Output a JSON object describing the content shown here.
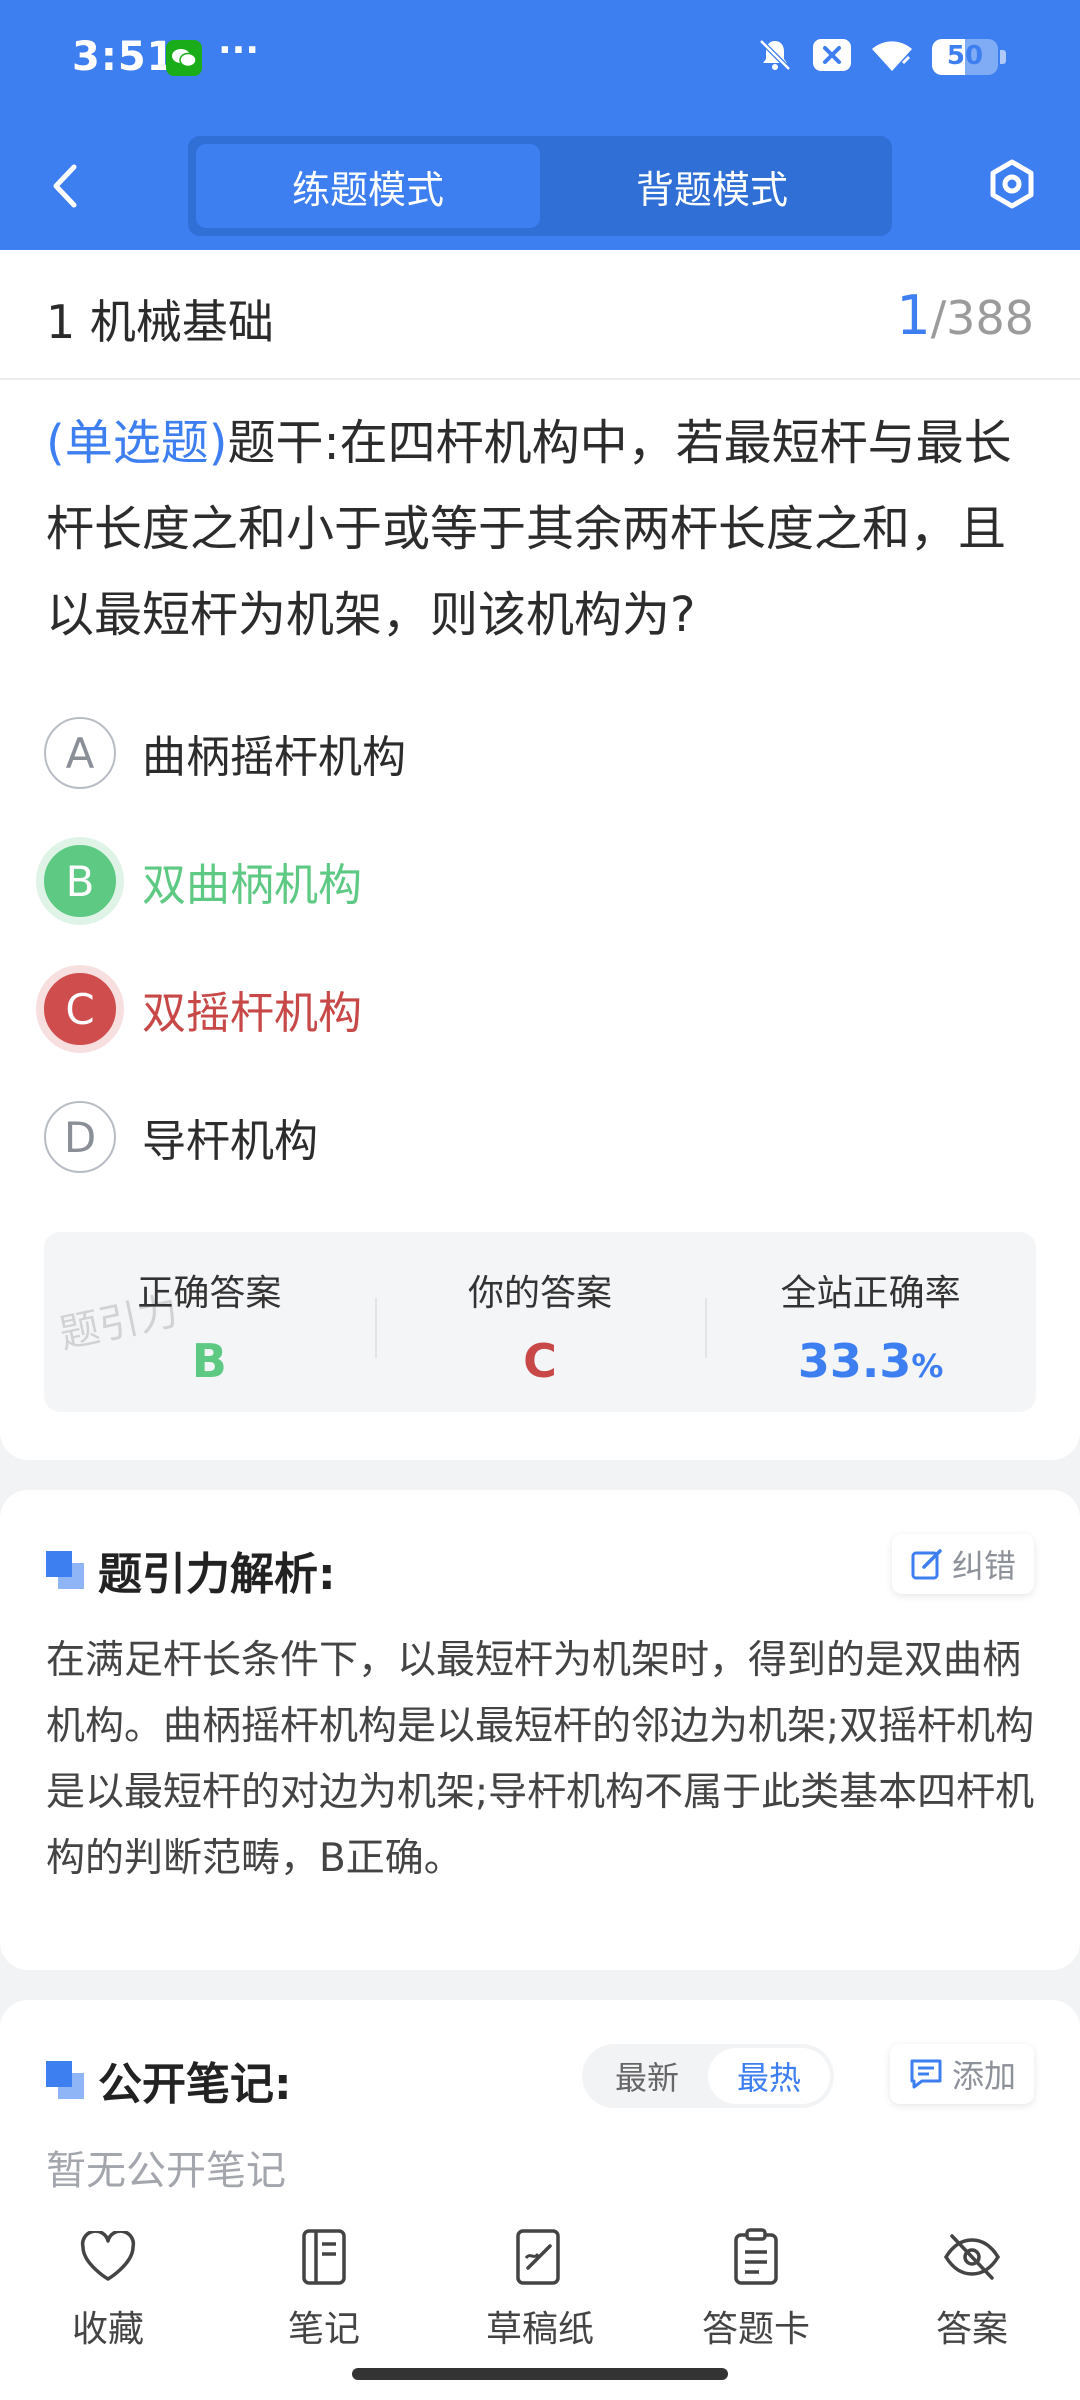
{
  "status": {
    "time": "3:51",
    "dots": "···",
    "battery": "50",
    "battery_level": 0.5
  },
  "nav": {
    "tabs": [
      {
        "label": "练题模式",
        "active": true
      },
      {
        "label": "背题模式",
        "active": false
      }
    ]
  },
  "section": {
    "title": "1 机械基础",
    "current": "1",
    "total": "/388"
  },
  "question": {
    "type": "(单选题)",
    "stem": "题干:在四杆机构中，若最短杆与最长杆长度之和小于或等于其余两杆长度之和，且以最短杆为机架，则该机构为?",
    "options": [
      {
        "letter": "A",
        "text": "曲柄摇杆机构",
        "state": "normal"
      },
      {
        "letter": "B",
        "text": "双曲柄机构",
        "state": "correct"
      },
      {
        "letter": "C",
        "text": "双摇杆机构",
        "state": "wrong"
      },
      {
        "letter": "D",
        "text": "导杆机构",
        "state": "normal"
      }
    ]
  },
  "answer": {
    "correct_label": "正确答案",
    "correct_value": "B",
    "yours_label": "你的答案",
    "yours_value": "C",
    "rate_label": "全站正确率",
    "rate_value": "33.3",
    "rate_unit": "%",
    "watermark": "题引力"
  },
  "analysis": {
    "title": "题引力解析:",
    "report_label": "纠错",
    "text": "在满足杆长条件下，以最短杆为机架时，得到的是双曲柄机构。曲柄摇杆机构是以最短杆的邻边为机架;双摇杆机构是以最短杆的对边为机架;导杆机构不属于此类基本四杆机构的判断范畴，B正确。"
  },
  "notes": {
    "title": "公开笔记:",
    "sort_latest": "最新",
    "sort_hot": "最热",
    "add_label": "添加",
    "empty": "暂无公开笔记"
  },
  "bottom_bar": [
    {
      "label": "收藏",
      "icon": "heart-icon"
    },
    {
      "label": "笔记",
      "icon": "notebook-icon"
    },
    {
      "label": "草稿纸",
      "icon": "draft-icon"
    },
    {
      "label": "答题卡",
      "icon": "answer-sheet-icon"
    },
    {
      "label": "答案",
      "icon": "eye-off-icon"
    }
  ],
  "colors": {
    "primary": "#3d7ef0",
    "correct": "#5dc983",
    "wrong": "#c84848"
  }
}
